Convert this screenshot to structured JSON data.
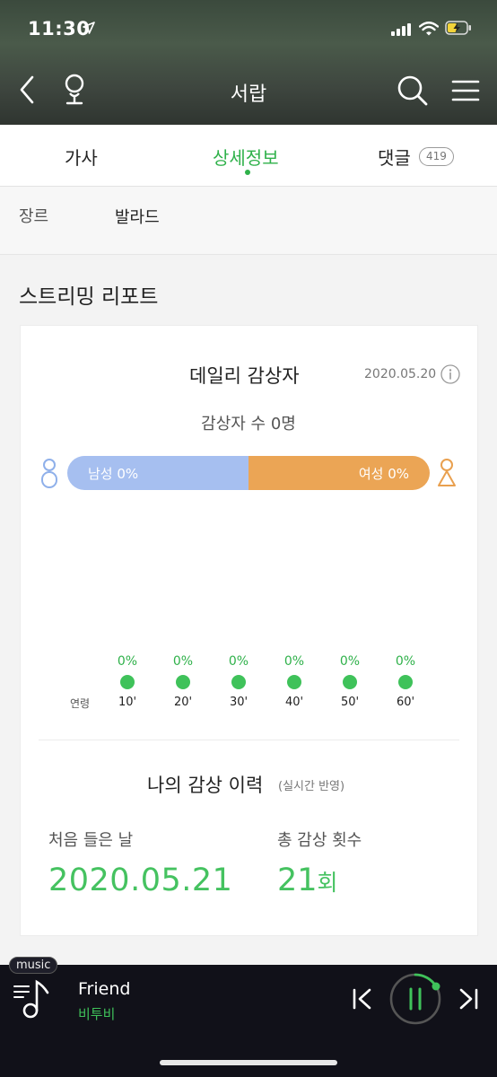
{
  "status_bar": {
    "time": "11:30"
  },
  "nav": {
    "title": "서랍"
  },
  "tabs": {
    "lyrics": "가사",
    "detail": "상세정보",
    "comments": "댓글",
    "comment_count": "419"
  },
  "genre": {
    "label": "장르",
    "value": "발라드"
  },
  "section_title": "스트리밍 리포트",
  "daily": {
    "title": "데일리 감상자",
    "date": "2020.05.20",
    "listener_count": "감상자 수 0명",
    "male_label": "남성 0%",
    "female_label": "여성 0%",
    "male_share": 0.5,
    "female_share": 0.5,
    "age_prefix": "연령",
    "ages": [
      {
        "label": "10'",
        "pct": "0%"
      },
      {
        "label": "20'",
        "pct": "0%"
      },
      {
        "label": "30'",
        "pct": "0%"
      },
      {
        "label": "40'",
        "pct": "0%"
      },
      {
        "label": "50'",
        "pct": "0%"
      },
      {
        "label": "60'",
        "pct": "0%"
      }
    ]
  },
  "history": {
    "title": "나의 감상 이력",
    "subtitle": "(실시간 반영)",
    "first_label": "처음 들은 날",
    "first_value": "2020.05.21",
    "count_label": "총 감상 횟수",
    "count_value": "21",
    "count_unit": "회"
  },
  "player": {
    "badge": "music",
    "song": "Friend",
    "artist": "비투비"
  },
  "colors": {
    "accent": "#2fb14a",
    "male": "#a6bff0",
    "female": "#eba555",
    "player_bg": "#111119"
  }
}
